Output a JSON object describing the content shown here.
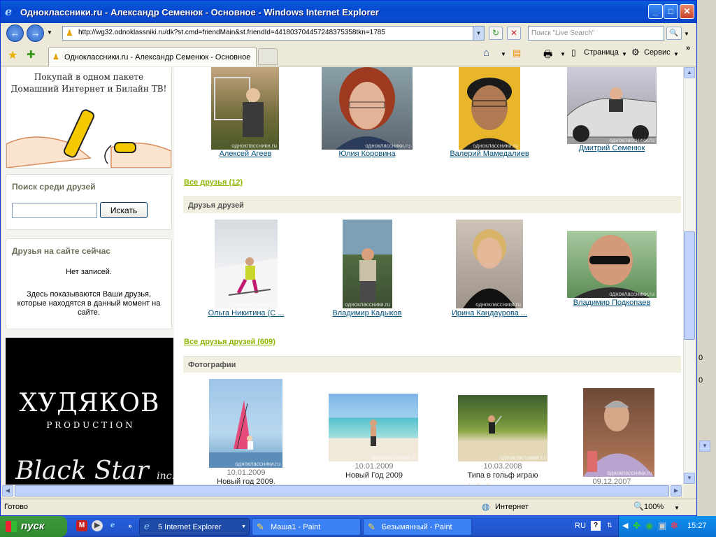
{
  "window": {
    "title": "Одноклассники.ru - Александр Семенюк - Основное - Windows Internet Explorer",
    "ie_glyph": "e",
    "minimize": "_",
    "maximize": "□",
    "close": "✕"
  },
  "addressbar": {
    "url": "http://wg32.odnoklassniki.ru/dk?st.cmd=friendMain&st.friendId=441803704457248375358tkn=1785",
    "search_placeholder": "Поиск \"Live Search\"",
    "back": "←",
    "forward": "→",
    "refresh": "↻",
    "stop": "✕",
    "search_go": "🔍"
  },
  "tabs": {
    "active_tab": "Одноклассники.ru - Александр Семенюк - Основное",
    "favorites_star": "★",
    "add_favorites": "✚"
  },
  "commandbar": {
    "page_label": "Страница",
    "tools_label": "Сервис",
    "home": "⌂",
    "feeds": "▤",
    "print": "🖶",
    "more": "»"
  },
  "sidebar": {
    "ad_text_line1": "Покупай в одном пакете",
    "ad_text_line2": "Домашний Интернет и Билайн ТВ!",
    "search_title": "Поиск среди друзей",
    "search_button": "Искать",
    "online_title": "Друзья на сайте сейчас",
    "no_records": "Нет записей.",
    "online_note": "Здесь показываются Ваши друзья, которые находятся в данный момент на сайте.",
    "banner_brand": "ХУДЯКОВ",
    "banner_sub": "P R O D U C T I O N",
    "banner_brand2": "Black Star",
    "banner_brand2_suffix": "inc."
  },
  "watermark": "одноклассники.ru",
  "friends": {
    "all_link": "Все друзья (12)",
    "items": [
      {
        "name": "Алексей Агеев"
      },
      {
        "name": "Юлия Коровина"
      },
      {
        "name": "Валерий Мамедалиев"
      },
      {
        "name": "Дмитрий Семенюк"
      }
    ]
  },
  "friends_of_friends": {
    "title": "Друзья друзей",
    "all_link": "Все друзья друзей (609)",
    "items": [
      {
        "name": "Ольга Никитина (С ..."
      },
      {
        "name": "Владимир Кадыков"
      },
      {
        "name": "Ирина Кандаурова ..."
      },
      {
        "name": "Владимир Подкопаев"
      }
    ]
  },
  "photos": {
    "title": "Фотографии",
    "items": [
      {
        "date": "10.01.2009",
        "caption": "Новый год 2009."
      },
      {
        "date": "10.01.2009",
        "caption": "Новый Год 2009"
      },
      {
        "date": "10.03.2008",
        "caption": "Типа в гольф играю"
      },
      {
        "date": "09.12.2007",
        "caption": ""
      }
    ]
  },
  "statusbar": {
    "status": "Готово",
    "zone": "Интернет",
    "zoom": "100%"
  },
  "taskbar": {
    "start": "пуск",
    "buttons": [
      {
        "label": "5 Internet Explorer"
      },
      {
        "label": "Маша1 - Paint"
      },
      {
        "label": "Безымянный - Paint"
      }
    ],
    "lang": "RU",
    "help_glyph": "?",
    "clock": "15:27"
  },
  "right_strip": {
    "values": [
      "0",
      "0"
    ]
  }
}
